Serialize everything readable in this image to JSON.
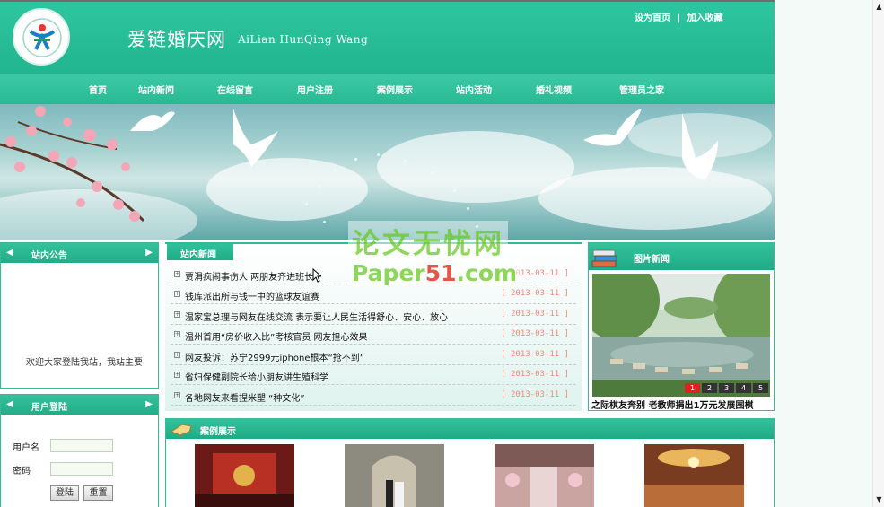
{
  "site": {
    "title_cn": "爱链婚庆网",
    "title_en": "AiLian HunQing Wang",
    "top_links": [
      "设为首页",
      "|",
      "加入收藏"
    ]
  },
  "nav": {
    "items": [
      "首页",
      "站内新闻",
      "在线留言",
      "用户注册",
      "案例展示",
      "站内活动",
      "婚礼视频",
      "管理员之家"
    ]
  },
  "notice": {
    "title": "站内公告",
    "marquee": "欢迎大家登陆我站，我站主要"
  },
  "login": {
    "title": "用户登陆",
    "username_label": "用户名",
    "password_label": "密码",
    "login_button": "登陆",
    "reset_button": "重置"
  },
  "news": {
    "title": "站内新闻",
    "items": [
      {
        "title": "贾涓疯闹事伤人 两朋友齐进班长",
        "date": "[ 2013-03-11 ]"
      },
      {
        "title": "钱库派出所与钱一中的篮球友谊赛",
        "date": "[ 2013-03-11 ]"
      },
      {
        "title": "温家宝总理与网友在线交流 表示要让人民生活得舒心、安心、放心",
        "date": "[ 2013-03-11 ]"
      },
      {
        "title": "温州首用“房价收入比”考核官员 网友担心效果",
        "date": "[ 2013-03-11 ]"
      },
      {
        "title": "网友投诉：苏宁2999元iphone根本“抢不到”",
        "date": "[ 2013-03-11 ]"
      },
      {
        "title": "省妇保健副院长给小朋友讲生殖科学",
        "date": "[ 2013-03-11 ]"
      },
      {
        "title": "各地网友来看捏米塑 “种文化”",
        "date": "[ 2013-03-11 ]"
      }
    ]
  },
  "photo_news": {
    "title": "图片新闻",
    "caption": "之际棋友奔别 老教师捐出1万元发展围棋",
    "pages": [
      "1",
      "2",
      "3",
      "4",
      "5"
    ],
    "active_page": "1"
  },
  "cases": {
    "title": "案例展示"
  },
  "watermark": {
    "line1": "论文无忧网",
    "line2_a": "Paper",
    "line2_b": "51",
    "line2_c": ".com"
  },
  "colors": {
    "primary": "#22b58f",
    "date": "#f08a7a",
    "watermark": "#7bd041"
  }
}
